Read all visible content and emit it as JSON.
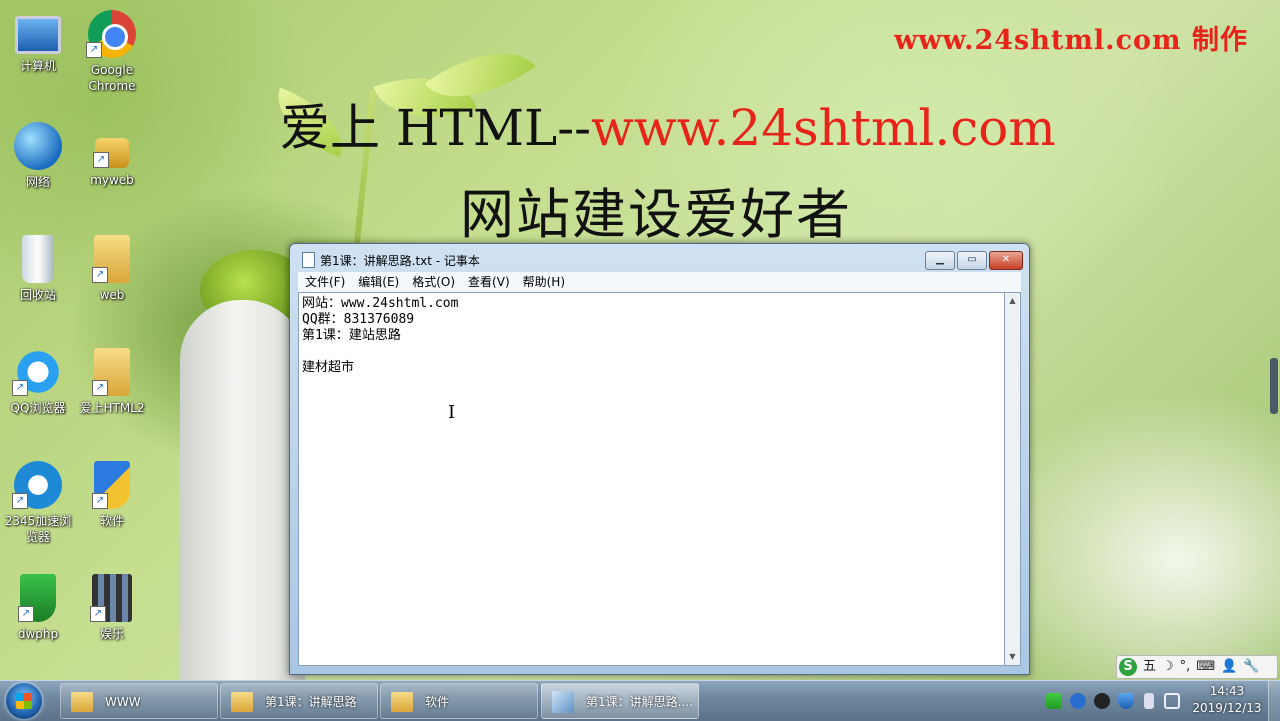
{
  "watermark": "www.24shtml.com 制作",
  "overlay": {
    "title_black": "爱上 HTML--",
    "title_red": "www.24shtml.com",
    "subtitle": "网站建设爱好者"
  },
  "desktop_icons": [
    {
      "label": "计算机"
    },
    {
      "label": "Google Chrome"
    },
    {
      "label": "网络"
    },
    {
      "label": "myweb"
    },
    {
      "label": "回收站"
    },
    {
      "label": "web"
    },
    {
      "label": "QQ浏览器"
    },
    {
      "label": "爱上HTML2"
    },
    {
      "label": "2345加速浏览器"
    },
    {
      "label": "软件"
    },
    {
      "label": "dwphp"
    },
    {
      "label": "娱乐"
    }
  ],
  "notepad": {
    "title": "第1课：讲解思路.txt - 记事本",
    "menu": [
      "文件(F)",
      "编辑(E)",
      "格式(O)",
      "查看(V)",
      "帮助(H)"
    ],
    "content": "网站：www.24shtml.com\nQQ群：831376089\n第1课：建站思路\n\n建材超市",
    "buttons": {
      "minimize": "▁",
      "maximize": "▭",
      "close": "✕"
    }
  },
  "taskbar": {
    "items": [
      {
        "label": "WWW",
        "icon": "folder-icon",
        "active": false
      },
      {
        "label": "第1课：讲解思路",
        "icon": "folder-icon",
        "active": false
      },
      {
        "label": "软件",
        "icon": "folder-icon",
        "active": false
      },
      {
        "label": "第1课：讲解思路....",
        "icon": "notepad-icon",
        "active": true
      }
    ],
    "clock_time": "14:43",
    "clock_date": "2019/12/13"
  },
  "ime_bar": {
    "mode": "五",
    "items": [
      "☽",
      "°,",
      "⌨",
      "👤",
      "🔧"
    ]
  },
  "colors": {
    "accent_red": "#e8231a",
    "taskbar": "#6f889f"
  }
}
